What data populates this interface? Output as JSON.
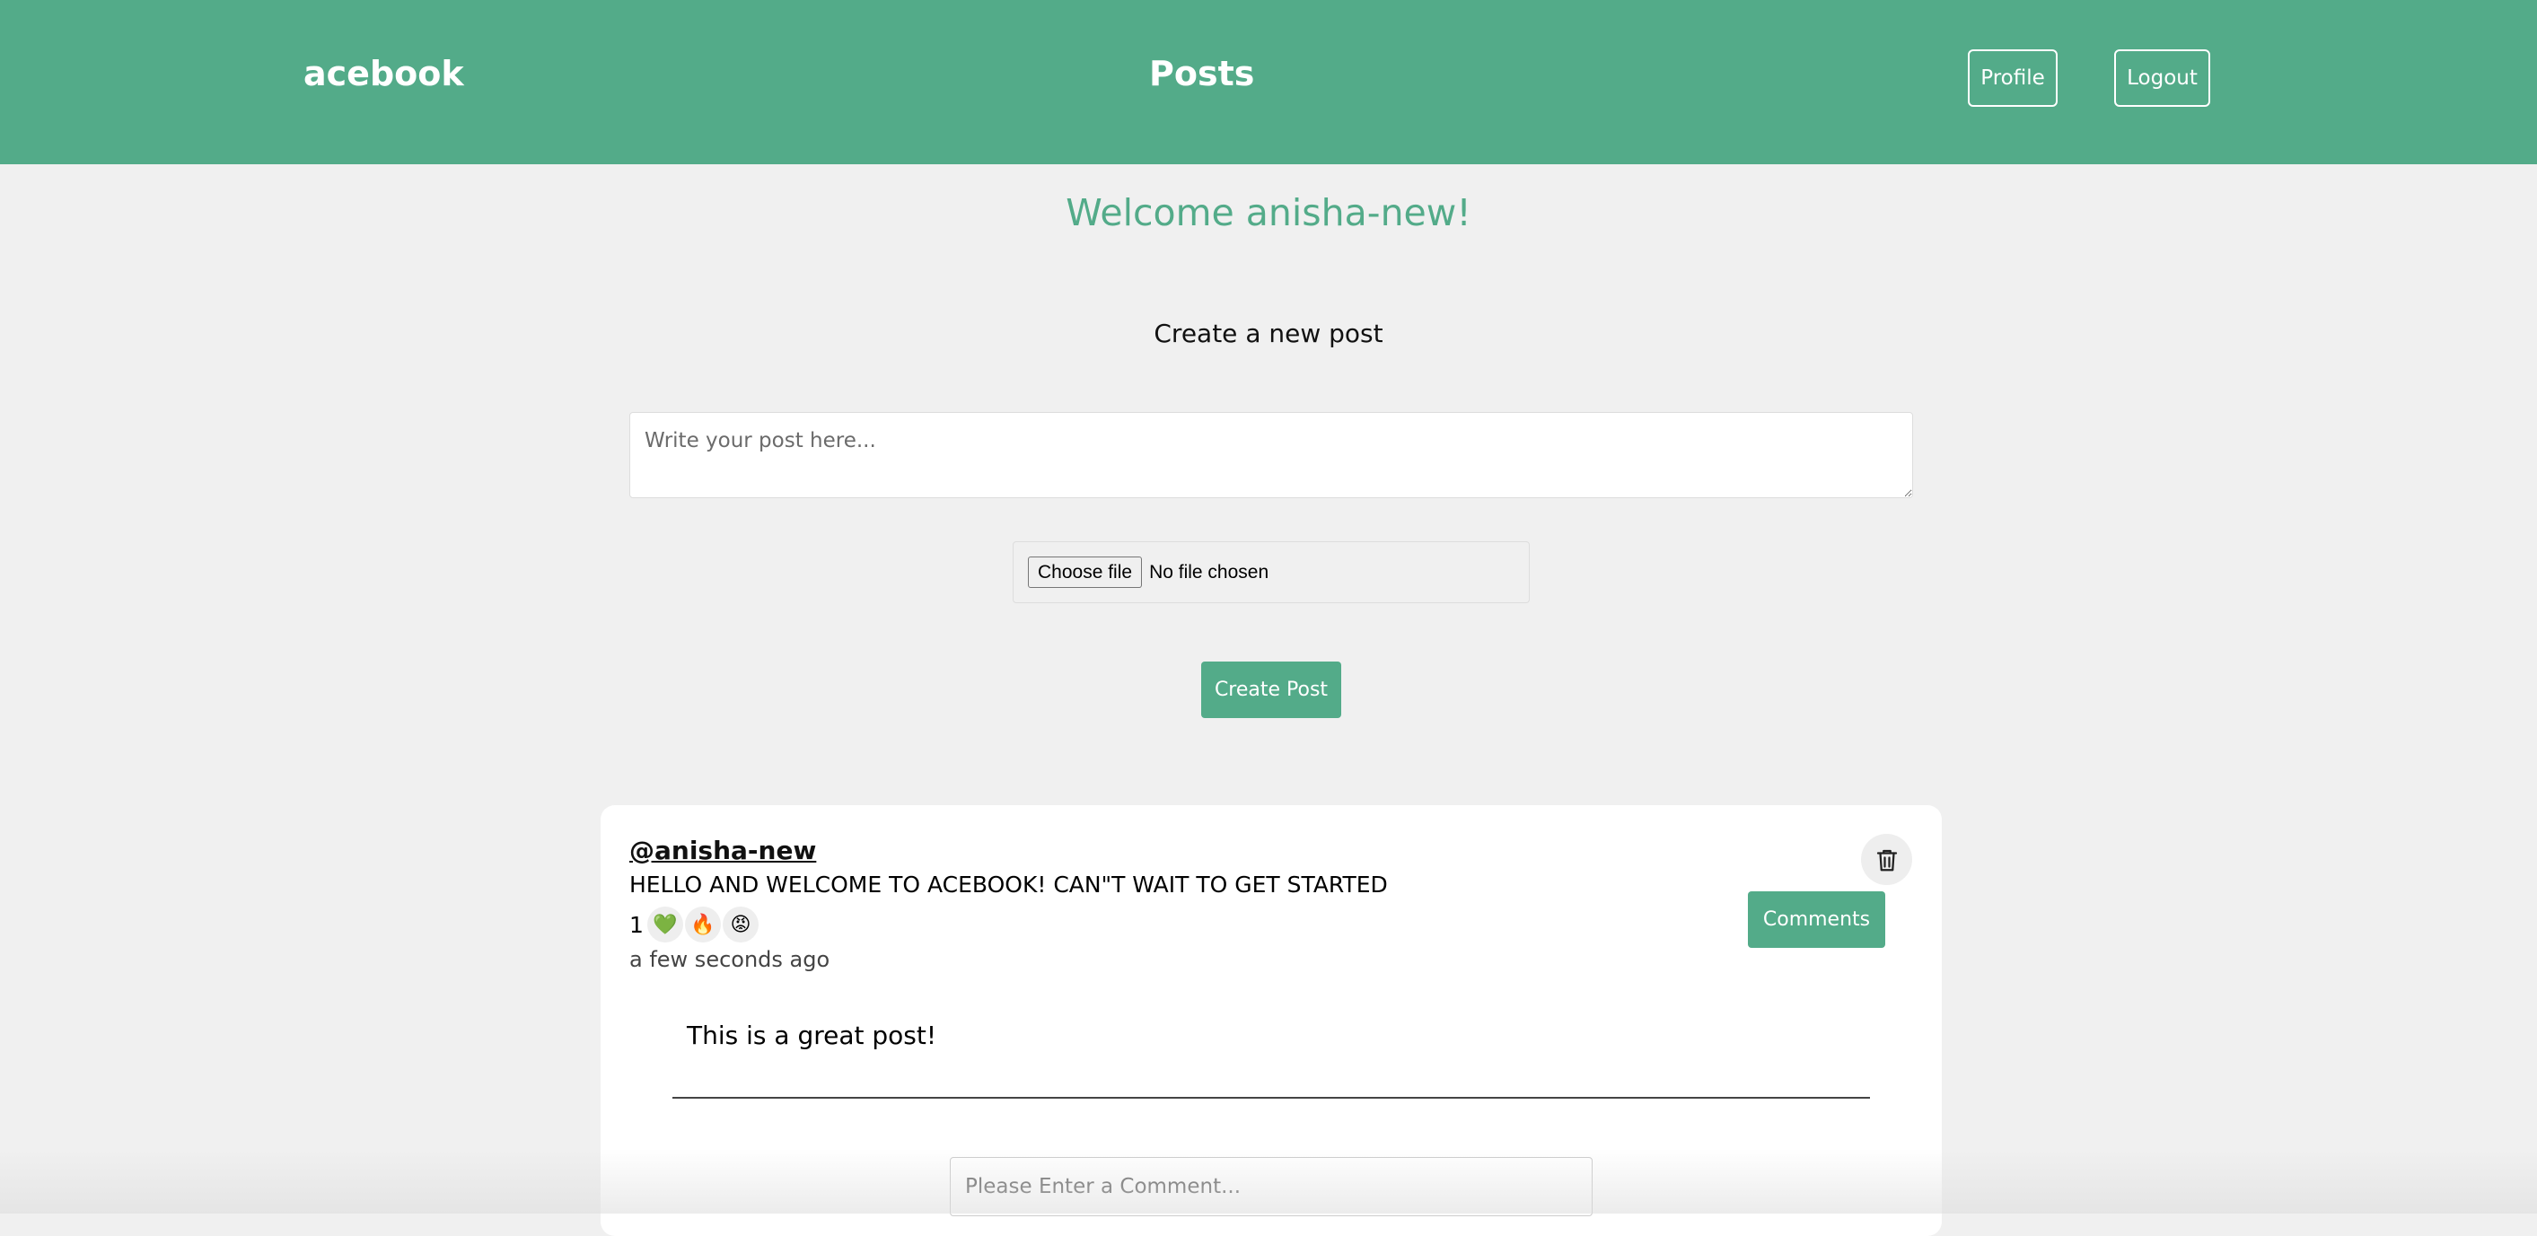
{
  "header": {
    "logo": "acebook",
    "title": "Posts",
    "profile_label": "Profile",
    "logout_label": "Logout"
  },
  "welcome": "Welcome anisha-new!",
  "create_post": {
    "heading": "Create a new post",
    "textarea_placeholder": "Write your post here...",
    "file_button_label": "Choose file",
    "file_status": "No file chosen",
    "submit_label": "Create Post"
  },
  "post": {
    "author": "@anisha-new",
    "text": "HELLO AND WELCOME TO ACEBOOK! CAN\"T WAIT TO GET STARTED",
    "reaction_count": "1",
    "reactions": [
      "💚",
      "🔥",
      "😡"
    ],
    "time": "a few seconds ago",
    "comments_label": "Comments",
    "delete_icon": "trash-icon",
    "comment": "This is a great post!",
    "comment_input_placeholder": "Please Enter a Comment..."
  },
  "colors": {
    "accent": "#53ab89",
    "background": "#f0f0f0"
  }
}
